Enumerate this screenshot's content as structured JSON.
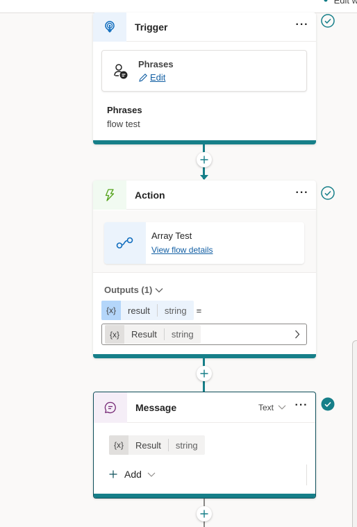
{
  "topbar": {
    "edit_hint": "Edit w"
  },
  "trigger": {
    "title": "Trigger",
    "more_label": "···",
    "phrase_card": {
      "title": "Phrases",
      "edit_label": "Edit"
    },
    "body_label": "Phrases",
    "body_value": "flow test",
    "status": "valid"
  },
  "action": {
    "title": "Action",
    "more_label": "···",
    "flow": {
      "name": "Array Test",
      "link_label": "View flow details"
    },
    "outputs_label": "Outputs (1)",
    "output_var": {
      "icon": "{x}",
      "name": "result",
      "type": "string"
    },
    "equals": "=",
    "assigned_var": {
      "icon": "{x}",
      "name": "Result",
      "type": "string"
    },
    "status": "valid"
  },
  "message": {
    "title": "Message",
    "type_label": "Text",
    "more_label": "···",
    "var": {
      "icon": "{x}",
      "name": "Result",
      "type": "string"
    },
    "add_label": "Add",
    "status": "selected-valid"
  },
  "colors": {
    "accent": "#167f89",
    "link": "#115ea3",
    "trigger_icon": "#0f6cbd",
    "action_icon": "#54a21a",
    "message_icon": "#742774"
  }
}
